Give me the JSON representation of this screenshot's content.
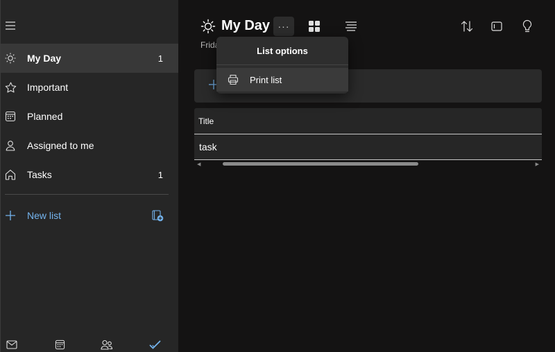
{
  "sidebar": {
    "items": [
      {
        "label": "My Day",
        "count": "1",
        "icon": "sun-icon",
        "active": true
      },
      {
        "label": "Important",
        "count": "",
        "icon": "star-icon"
      },
      {
        "label": "Planned",
        "count": "",
        "icon": "calendar-icon"
      },
      {
        "label": "Assigned to me",
        "count": "",
        "icon": "person-icon"
      },
      {
        "label": "Tasks",
        "count": "1",
        "icon": "home-icon"
      }
    ],
    "new_list_label": "New list"
  },
  "main": {
    "title": "My Day",
    "date": "Frida",
    "more_label": "···"
  },
  "table": {
    "header": "Title",
    "rows": [
      "task"
    ]
  },
  "dropdown": {
    "title": "List options",
    "items": [
      {
        "label": "Print list",
        "icon": "printer-icon"
      }
    ]
  },
  "colors": {
    "accent": "#74b4ee",
    "sidebar_bg": "#262626",
    "main_bg": "#141313"
  }
}
